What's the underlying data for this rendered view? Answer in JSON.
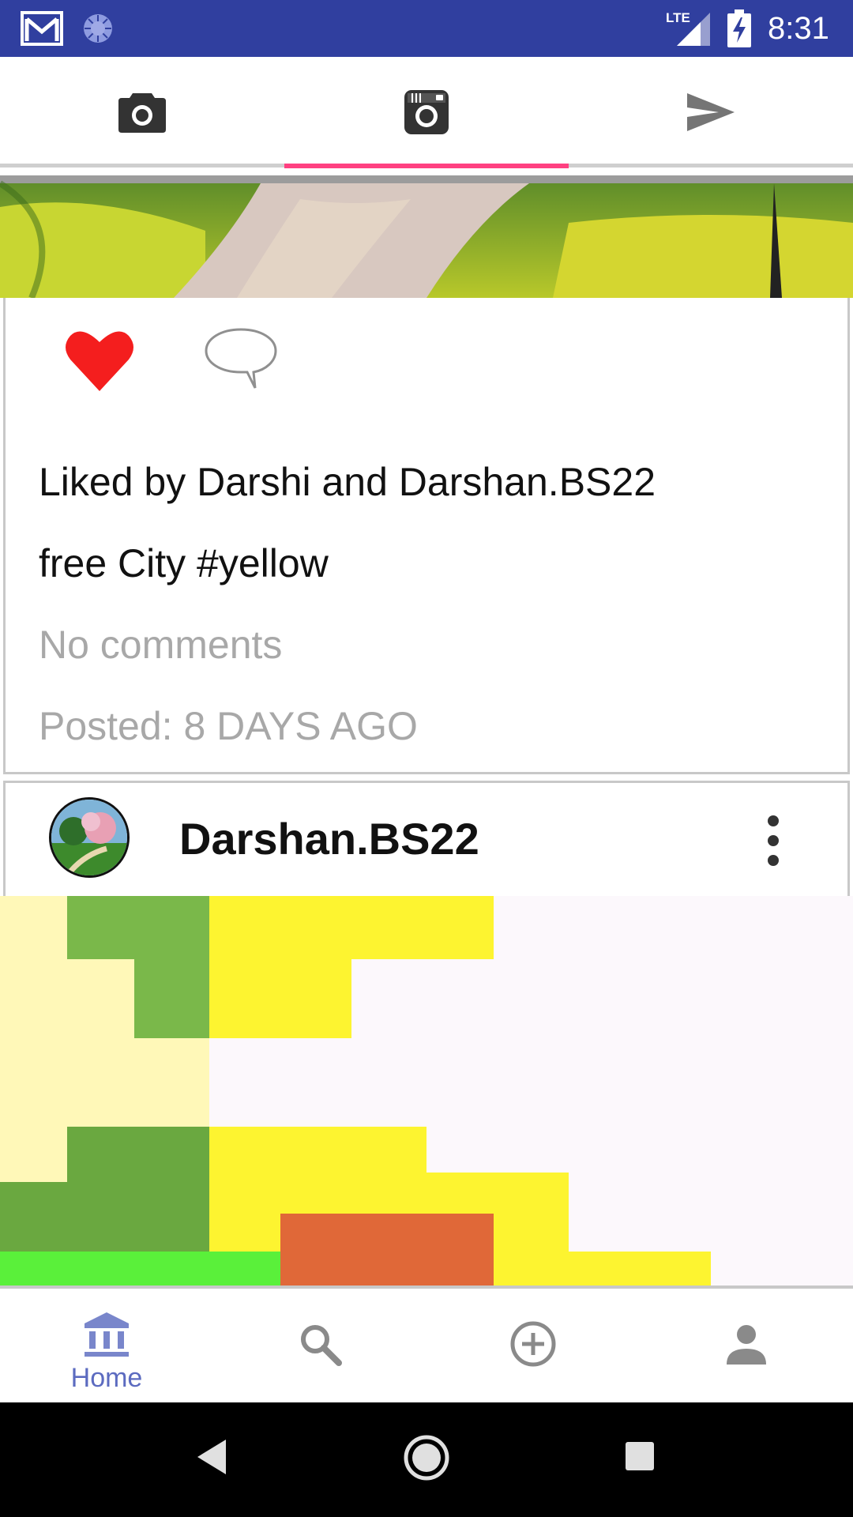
{
  "status_bar": {
    "time": "8:31",
    "network": "LTE",
    "icons": [
      "gmail-icon",
      "sync-icon",
      "lte-signal-icon",
      "battery-charging-icon"
    ],
    "color": "#303f9f"
  },
  "top_tabs": {
    "items": [
      {
        "icon": "camera-icon"
      },
      {
        "icon": "instagram-icon"
      },
      {
        "icon": "send-icon"
      }
    ],
    "active_index": 1,
    "indicator_color": "#ff4081"
  },
  "post1": {
    "liked": true,
    "liked_by": "Liked by Darshi and Darshan.BS22",
    "caption": "free City #yellow",
    "comments": "No comments",
    "posted": "Posted: 8 DAYS AGO"
  },
  "post2": {
    "username": "Darshan.BS22"
  },
  "bottom_nav": {
    "items": [
      {
        "icon": "home-icon",
        "label": "Home",
        "active": true
      },
      {
        "icon": "search-icon"
      },
      {
        "icon": "add-circle-icon"
      },
      {
        "icon": "profile-icon"
      }
    ],
    "active_color": "#7986cb"
  }
}
